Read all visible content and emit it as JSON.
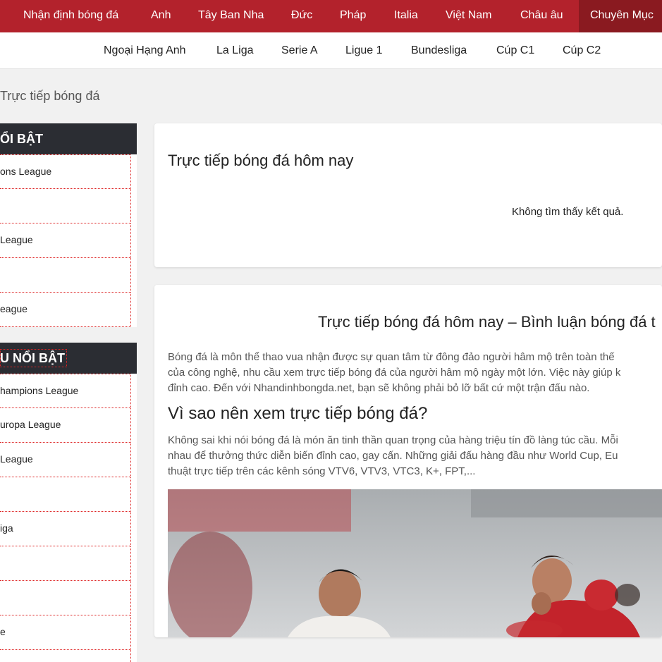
{
  "topnav": {
    "items": [
      "Nhận định bóng đá",
      "Anh",
      "Tây Ban Nha",
      "Đức",
      "Pháp",
      "Italia",
      "Việt Nam",
      "Châu âu",
      "Chuyên Mục"
    ],
    "active": "Chuyên Mục"
  },
  "subnav": {
    "items": [
      "Ngoại Hạng Anh",
      "La Liga",
      "Serie A",
      "Ligue 1",
      "Bundesliga",
      "Cúp C1",
      "Cúp C2"
    ]
  },
  "breadcrumb": "Trực tiếp bóng đá",
  "sidebar": {
    "box1": {
      "title": "ỔI BẬT",
      "items": [
        "ons League",
        "",
        "League",
        "",
        "eague"
      ]
    },
    "box2": {
      "title": "U NỔI BẬT",
      "items": [
        "hampions League",
        "uropa League",
        "League",
        "",
        "iga",
        "",
        "",
        "e",
        ""
      ]
    }
  },
  "live": {
    "title": "Trực tiếp bóng đá hôm nay",
    "empty": "Không tìm thấy kết quả."
  },
  "article": {
    "title": "Trực tiếp bóng đá hôm nay – Bình luận bóng đá t",
    "p1": [
      "Bóng đá là môn thể thao vua nhận được sự quan tâm từ đông đảo người hâm mộ trên toàn thế",
      "của công nghệ, nhu cầu xem trực tiếp bóng đá của người hâm mộ ngày một lớn. Việc này giúp k",
      "đỉnh cao. Đến với Nhandinhbongda.net, bạn sẽ không phải bỏ lỡ bất cứ một trận đấu nào."
    ],
    "h3": "Vì sao nên xem trực tiếp bóng đá?",
    "p2": [
      "Không sai khi nói bóng đá là món ăn tinh thần quan trọng của hàng triệu tín đồ làng túc cầu. Mỗi",
      "nhau để thưởng thức diễn biến đỉnh cao, gay cấn. Những giải đấu hàng đầu như World Cup, Eu",
      "thuật trực tiếp trên các kênh sóng VTV6, VTV3, VTC3, K+, FPT,..."
    ]
  }
}
